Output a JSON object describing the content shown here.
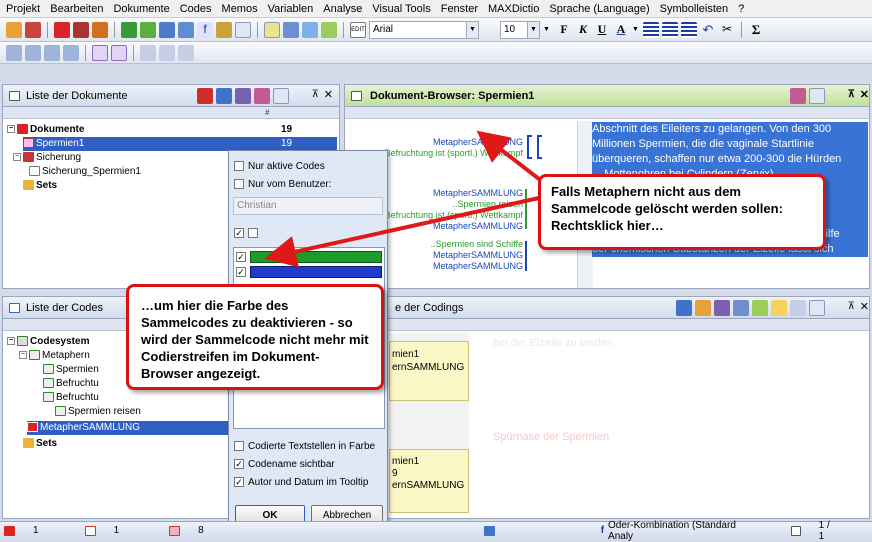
{
  "menu": [
    "Projekt",
    "Bearbeiten",
    "Dokumente",
    "Codes",
    "Memos",
    "Variablen",
    "Analyse",
    "Visual Tools",
    "Fenster",
    "MAXDictio",
    "Sprache (Language)",
    "Symbolleisten",
    "?"
  ],
  "toolbar": {
    "font": "Arial",
    "size": "10",
    "sigma": "Σ"
  },
  "doc_panel": {
    "title": "Liste der Dokumente",
    "root": "Dokumente",
    "root_count": "19",
    "doc1": "Spermien1",
    "doc1_count": "19",
    "group2": "Sicherung",
    "doc2": "Sicherung_Spermien1",
    "sets": "Sets",
    "col": "#"
  },
  "browser": {
    "title": "Dokument-Browser: Spermien1",
    "text_lines": [
      "Abschnitt des Eileiters zu gelangen. Von den 300",
      "Millionen Spermien, die die vaginale Startlinie",
      "überqueren, schaffen nur etwa 200-300 die Hürden",
      "... Mottenohren bei Cylindern (Zervix)...",
      "... e",
      "...",
      "um letztlich bei der Eizelle zu landen, ist die",
      "Spürnase der Spermien gefragt. Denn nur mit Hilfe",
      "der chemischen Substanzen der Eizelle lässt sich"
    ],
    "margin_codes": [
      "MetapherSAMMLUNG",
      "Befruchtung ist (sportl.) Wettkampf",
      "MetapherSAMMLUNG",
      "..Spermien reisen",
      "Befruchtung ist (sportl.) Wettkampf",
      "MetapherSAMMLUNG",
      "..Spermien sind Schiffe",
      "MetapherSAMMLUNG",
      "MetapherSAMMLUNG"
    ]
  },
  "codes_panel": {
    "title": "Liste der Codes",
    "root": "Codesystem",
    "n1": "Metaphern",
    "c1": "Spermien",
    "c2": "Befruchtu",
    "c3": "Befruchtu",
    "c4": "Spermien reisen",
    "sel": "MetapherSAMMLUNG",
    "sets": "Sets"
  },
  "codings_panel": {
    "title": "e der Codings",
    "faded1": "bei der Eizelle zu landen",
    "faded2": "Spürnase der Spermien",
    "card1": [
      "mien1",
      "ernSAMMLUNG"
    ],
    "card2": [
      "mien1",
      "9",
      "ernSAMMLUNG"
    ]
  },
  "popup": {
    "opt1": "Nur aktive Codes",
    "opt2": "Nur vom Benutzer:",
    "user": "Christian",
    "opt3": "Codierte Textstellen in Farbe",
    "opt4": "Codename sichtbar",
    "opt5": "Autor und Datum im Tooltip",
    "ok": "OK",
    "cancel": "Abbrechen"
  },
  "callouts": {
    "c1": "Falls Metaphern nicht aus dem Sammelcode gelöscht werden sollen: Rechtsklick hier…",
    "c2": "…um hier die Farbe des Sammelcodes zu deaktivieren - so wird der Sammelcode nicht mehr mit Codierstreifen im Dokument-Browser angezeigt."
  },
  "status": {
    "s1": "1",
    "s2": "1",
    "s3": "8",
    "s4": "Oder-Kombination (Standard Analy",
    "s5": "1 / 1"
  },
  "colors": {
    "accent": "#2f5fc2",
    "callout_border": "#dd1111",
    "swatch_green": "#1a9b2a",
    "swatch_blue": "#1d3cc9"
  }
}
